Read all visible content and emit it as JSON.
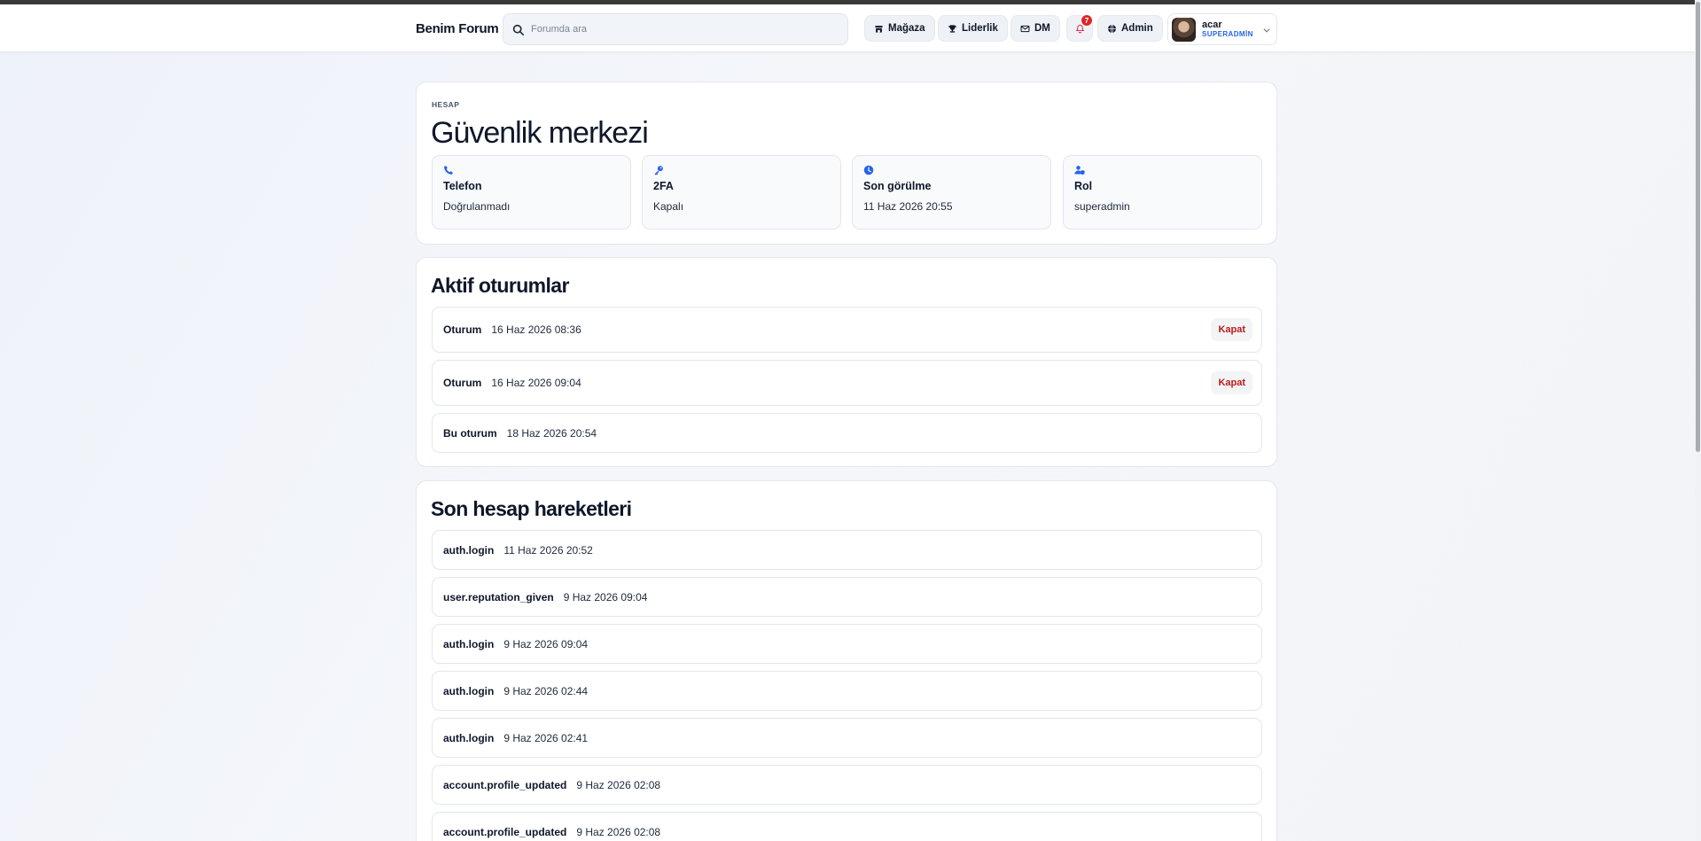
{
  "header": {
    "brand": "Benim Forum",
    "search_placeholder": "Forumda ara",
    "nav": {
      "store": "Mağaza",
      "leaderboard": "Liderlik",
      "dm": "DM",
      "admin": "Admin"
    },
    "notifications_count": "7",
    "user": {
      "name": "acar",
      "role": "SUPERADMİN"
    }
  },
  "security": {
    "eyebrow": "HESAP",
    "title": "Güvenlik merkezi",
    "stats": [
      {
        "icon": "phone-icon",
        "label": "Telefon",
        "value": "Doğrulanmadı"
      },
      {
        "icon": "key-icon",
        "label": "2FA",
        "value": "Kapalı"
      },
      {
        "icon": "clock-icon",
        "label": "Son görülme",
        "value": "11 Haz 2026 20:55"
      },
      {
        "icon": "user-shield-icon",
        "label": "Rol",
        "value": "superadmin"
      }
    ]
  },
  "sessions": {
    "title": "Aktif oturumlar",
    "close_label": "Kapat",
    "items": [
      {
        "label": "Oturum",
        "time": "16 Haz 2026 08:36"
      },
      {
        "label": "Oturum",
        "time": "16 Haz 2026 09:04"
      },
      {
        "label": "Bu oturum",
        "time": "18 Haz 2026 20:54"
      }
    ]
  },
  "activity": {
    "title": "Son hesap hareketleri",
    "items": [
      {
        "event": "auth.login",
        "time": "11 Haz 2026 20:52"
      },
      {
        "event": "user.reputation_given",
        "time": "9 Haz 2026 09:04"
      },
      {
        "event": "auth.login",
        "time": "9 Haz 2026 09:04"
      },
      {
        "event": "auth.login",
        "time": "9 Haz 2026 02:44"
      },
      {
        "event": "auth.login",
        "time": "9 Haz 2026 02:41"
      },
      {
        "event": "account.profile_updated",
        "time": "9 Haz 2026 02:08"
      },
      {
        "event": "account.profile_updated",
        "time": "9 Haz 2026 02:08"
      }
    ]
  },
  "colors": {
    "accent": "#2563eb",
    "danger": "#b91c1c",
    "badge": "#dc2626"
  }
}
